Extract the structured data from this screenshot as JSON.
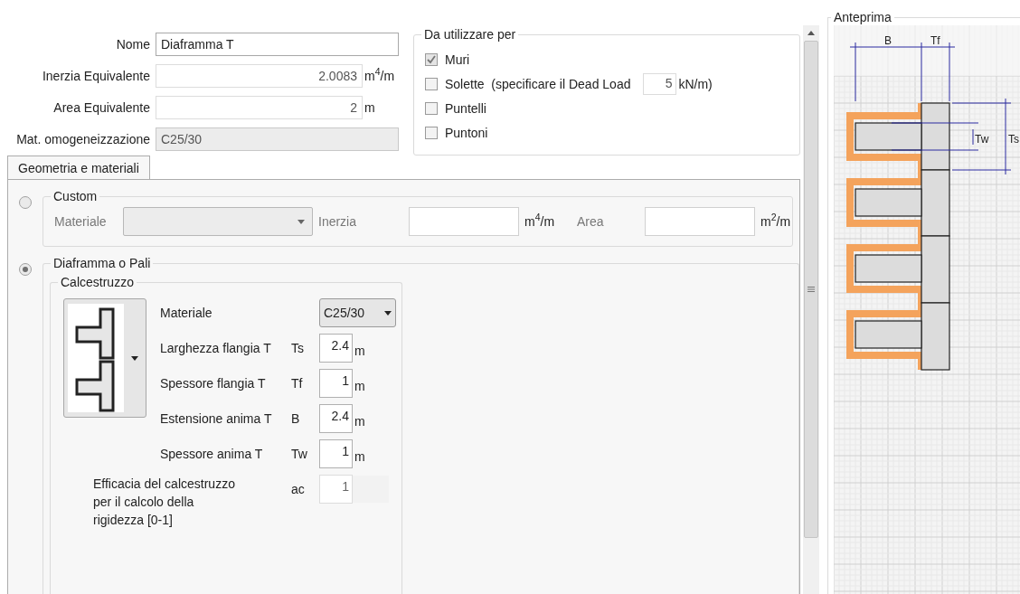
{
  "fields": [
    {
      "label": "Nome",
      "value": "Diaframma T",
      "kind": "text",
      "disabled": false
    },
    {
      "label": "Inerzia Equivalente",
      "value": "2.0083",
      "unit": "m$^{4}$/m",
      "kind": "number",
      "disabled": false
    },
    {
      "label": "Area Equivalente",
      "value": "2",
      "unit": "m",
      "kind": "number",
      "disabled": false
    },
    {
      "label": "Mat. omogeneizzazione",
      "value": "C25/30",
      "kind": "text",
      "disabled": true
    }
  ],
  "usage": {
    "title": "Da utilizzare per",
    "items": [
      {
        "label": "Muri",
        "checked": true,
        "disabled": true
      },
      {
        "label": "Solette  (specificare il Dead Load",
        "checked": false,
        "disabled": false,
        "input": {
          "value": "5",
          "unit": "kN/m)"
        }
      },
      {
        "label": "Puntelli",
        "checked": false,
        "disabled": false
      },
      {
        "label": "Puntoni",
        "checked": false,
        "disabled": false
      }
    ]
  },
  "tabs": [
    {
      "label": "Geometria e materiali",
      "selected": true
    }
  ],
  "custom": {
    "title": "Custom",
    "selected": false,
    "material_label": "Materiale",
    "inertia_label": "Inerzia",
    "inertia_unit": "m$^{4}$/m",
    "area_label": "Area",
    "area_unit": "m$^{2}$/m"
  },
  "diaphragm": {
    "title": "Diaframma o Pali",
    "selected": true,
    "group": {
      "title": "Calcestruzzo",
      "material_label": "Materiale",
      "material_value": "C25/30",
      "params": [
        {
          "label": "Larghezza flangia T",
          "symbol": "Ts",
          "value": "2.4",
          "unit": "m",
          "disabled": false,
          "kind": "row"
        },
        {
          "label": "Spessore flangia T",
          "symbol": "Tf",
          "value": "1",
          "unit": "m",
          "disabled": false,
          "kind": "row"
        },
        {
          "label": "Estensione anima T",
          "symbol": "B",
          "value": "2.4",
          "unit": "m",
          "disabled": false,
          "kind": "row"
        },
        {
          "label": "Spessore anima T",
          "symbol": "Tw",
          "value": "1",
          "unit": "m",
          "disabled": false,
          "kind": "row"
        },
        {
          "label": "Efficacia del calcestruzzo per il calcolo della rigidezza  [0-1]",
          "symbol": "ac",
          "value": "1",
          "disabled": true,
          "kind": "wide"
        }
      ]
    }
  },
  "preview": {
    "title": "Anteprima",
    "labels": {
      "b": "B",
      "tf": "Tf",
      "tw": "Tw",
      "ts": "Ts"
    }
  }
}
